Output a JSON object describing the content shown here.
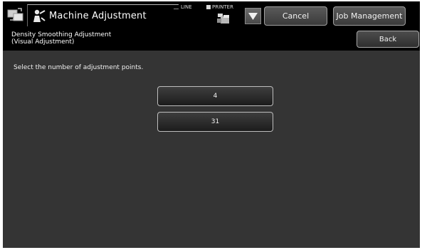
{
  "header": {
    "title": "Machine Adjustment",
    "mode_icon": "copy-mode-icon",
    "title_icon": "adjustment-person-icon",
    "status": {
      "line_label": "LINE",
      "printer_label": "PRINTER",
      "printer_icon": "printer-icon"
    },
    "dropdown_icon": "triangle-down-icon",
    "cancel_label": "Cancel",
    "job_management_label": "Job Management"
  },
  "subheader": {
    "title_line1": "Density Smoothing Adjustment",
    "title_line2": "(Visual Adjustment)",
    "back_label": "Back"
  },
  "main": {
    "instruction": "Select the number of adjustment points.",
    "options": [
      {
        "label": "4"
      },
      {
        "label": "31"
      }
    ]
  }
}
